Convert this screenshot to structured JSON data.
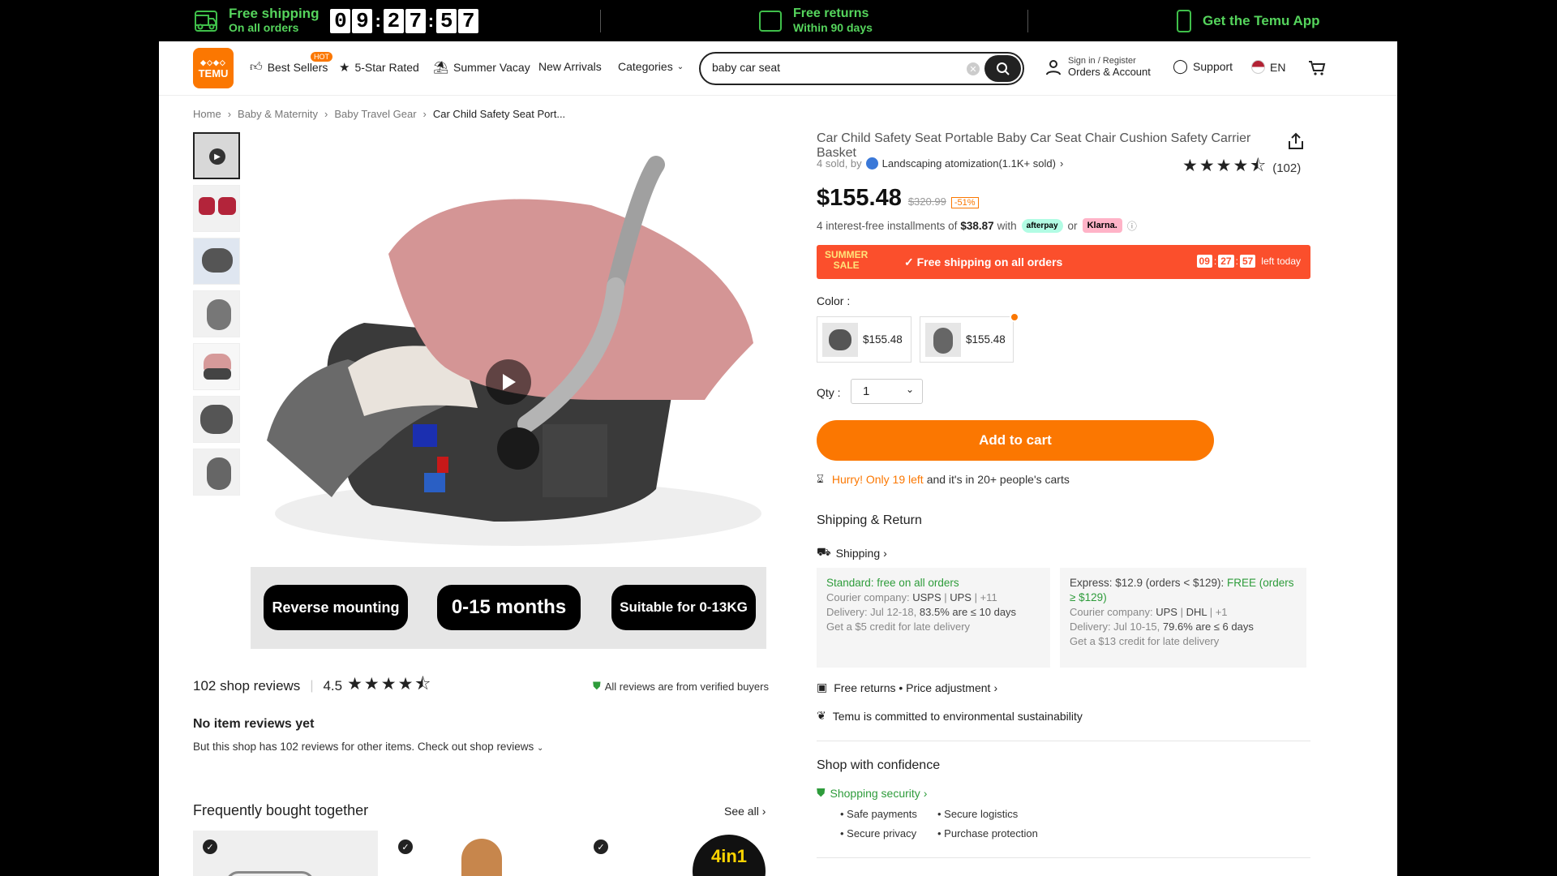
{
  "topbar": {
    "free_shipping_line1": "Free shipping",
    "free_shipping_line2": "On all orders",
    "timer_digits": [
      "0",
      "9",
      "2",
      "7",
      "5",
      "7"
    ],
    "free_returns_line1": "Free returns",
    "free_returns_line2": "Within 90 days",
    "app": "Get the Temu App"
  },
  "header": {
    "logo_line1": "TEMU",
    "best_sellers": "Best Sellers",
    "hot_badge": "HOT",
    "five_star": "5-Star Rated",
    "summer_vacay": "Summer Vacay",
    "new_arrivals": "New Arrivals",
    "categories": "Categories",
    "search_value": "baby car seat",
    "sign_in": "Sign in / Register",
    "orders_account": "Orders & Account",
    "support": "Support",
    "lang": "EN"
  },
  "breadcrumb": [
    "Home",
    "Baby & Maternity",
    "Baby Travel Gear",
    "Car Child Safety Seat Port..."
  ],
  "gallery": {
    "tags": [
      "Reverse mounting",
      "0-15 months",
      "Suitable for 0-13KG"
    ]
  },
  "reviews": {
    "shop_reviews": "102 shop reviews",
    "score": "4.5",
    "verified": "All reviews are from verified buyers",
    "no_item": "No item reviews yet",
    "no_item_sub": "But this shop has 102 reviews for other items. Check out shop reviews"
  },
  "fbt": {
    "title": "Frequently bought together",
    "see_all": "See all",
    "card3_text": "4in1"
  },
  "product": {
    "title": "Car Child Safety Seat Portable Baby Car Seat Chair Cushion Safety Carrier Basket",
    "sold": "4 sold, by",
    "shop": "Landscaping atomization(1.1K+ sold)",
    "rating_count": "(102)",
    "price": "$155.48",
    "orig_price": "$320.99",
    "discount": "-51%",
    "install_pre": "4 interest-free installments of",
    "install_amt": "$38.87",
    "install_with": "with",
    "afterpay": "afterpay",
    "or": "or",
    "klarna": "Klarna."
  },
  "banner": {
    "summer": "SUMMER",
    "sale": "SALE",
    "free": "Free shipping on all orders",
    "t1": "09",
    "t2": "27",
    "t3": "57",
    "left": "left today"
  },
  "color": {
    "label": "Color :",
    "options": [
      {
        "price": "$155.48"
      },
      {
        "price": "$155.48"
      }
    ]
  },
  "qty": {
    "label": "Qty :",
    "value": "1"
  },
  "add_to_cart": "Add to cart",
  "hurry": {
    "orange": "Hurry! Only 19 left",
    "rest": "and it's in 20+ people's carts"
  },
  "shipping": {
    "section": "Shipping & Return",
    "label": "Shipping",
    "standard": {
      "title": "Standard: free on all orders",
      "courier_label": "Courier company:",
      "c1": "USPS",
      "c2": "UPS",
      "more": "+11",
      "delivery": "Delivery: Jul 12-18,",
      "pct": "83.5% are ≤ 10 days",
      "credit": "Get a $5 credit for late delivery"
    },
    "express": {
      "title": "Express: $12.9 (orders < $129):",
      "free": "FREE (orders ≥ $129)",
      "courier_label": "Courier company:",
      "c1": "UPS",
      "c2": "DHL",
      "more": "+1",
      "delivery": "Delivery: Jul 10-15,",
      "pct": "79.6% are ≤ 6 days",
      "credit": "Get a $13 credit for late delivery"
    },
    "returns": "Free returns • Price adjustment",
    "env": "Temu is committed to environmental sustainability"
  },
  "confidence": {
    "title": "Shop with confidence",
    "security": "Shopping security",
    "bullets": [
      "Safe payments",
      "Secure logistics",
      "Secure privacy",
      "Purchase protection"
    ]
  }
}
